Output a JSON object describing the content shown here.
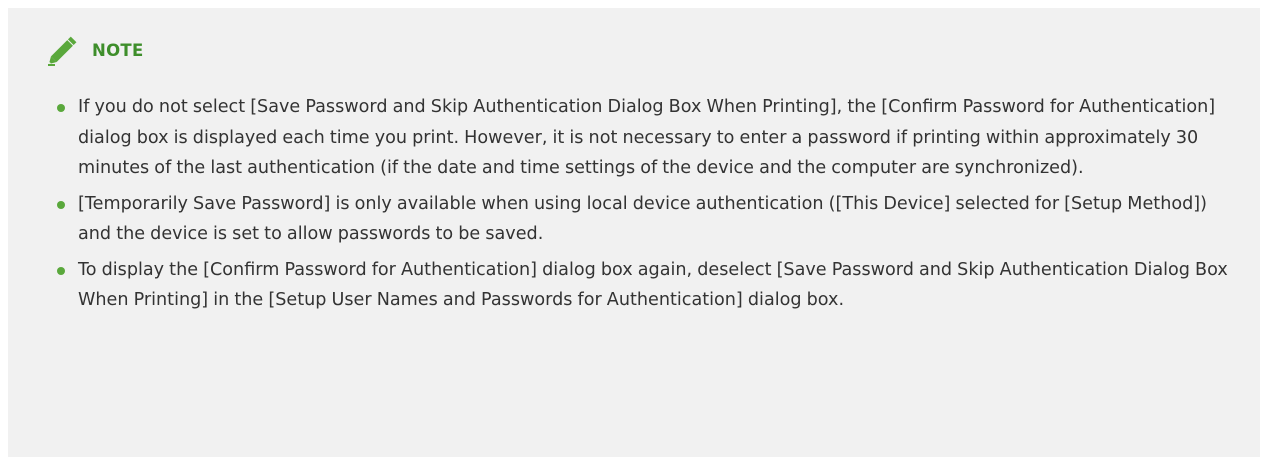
{
  "note": {
    "title": "NOTE",
    "icon": "pencil-icon",
    "accent_color": "#5aa83c",
    "items": [
      "If you do not select [Save Password and Skip Authentication Dialog Box When Printing], the [Confirm Password for Authentication] dialog box is displayed each time you print. However, it is not necessary to enter a password if printing within approximately 30 minutes of the last authentication (if the date and time settings of the device and the computer are synchronized).",
      "[Temporarily Save Password] is only available when using local device authentication ([This Device] selected for [Setup Method]) and the device is set to allow passwords to be saved.",
      "To display the [Confirm Password for Authentication] dialog box again, deselect [Save Password and Skip Authentication Dialog Box When Printing] in the [Setup User Names and Passwords for Authentication] dialog box."
    ]
  }
}
